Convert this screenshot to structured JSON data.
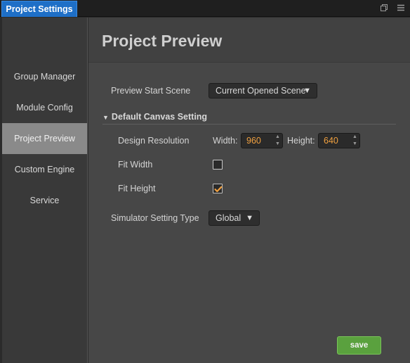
{
  "tab": {
    "title": "Project Settings"
  },
  "tab_icons": [
    "restore-icon",
    "menu-icon"
  ],
  "sidebar": {
    "items": [
      {
        "label": "Group Manager"
      },
      {
        "label": "Module Config"
      },
      {
        "label": "Project Preview",
        "active": true
      },
      {
        "label": "Custom Engine"
      },
      {
        "label": "Service"
      }
    ]
  },
  "main": {
    "title": "Project Preview",
    "preview_start_scene": {
      "label": "Preview Start Scene",
      "value": "Current Opened Scene"
    },
    "section": {
      "arrow": "▼",
      "title": "Default Canvas Setting"
    },
    "design_resolution": {
      "label": "Design Resolution",
      "width_label": "Width:",
      "width_value": "960",
      "height_label": "Height:",
      "height_value": "640"
    },
    "fit_width": {
      "label": "Fit Width",
      "checked": false
    },
    "fit_height": {
      "label": "Fit Height",
      "checked": true
    },
    "simulator_setting": {
      "label": "Simulator Setting Type",
      "value": "Global"
    },
    "save_label": "save"
  },
  "colors": {
    "tab_active": "#1e6fc7",
    "accent_value": "#f0a040",
    "save_button": "#5aa13e",
    "sidebar_active": "#8a8a8a"
  }
}
